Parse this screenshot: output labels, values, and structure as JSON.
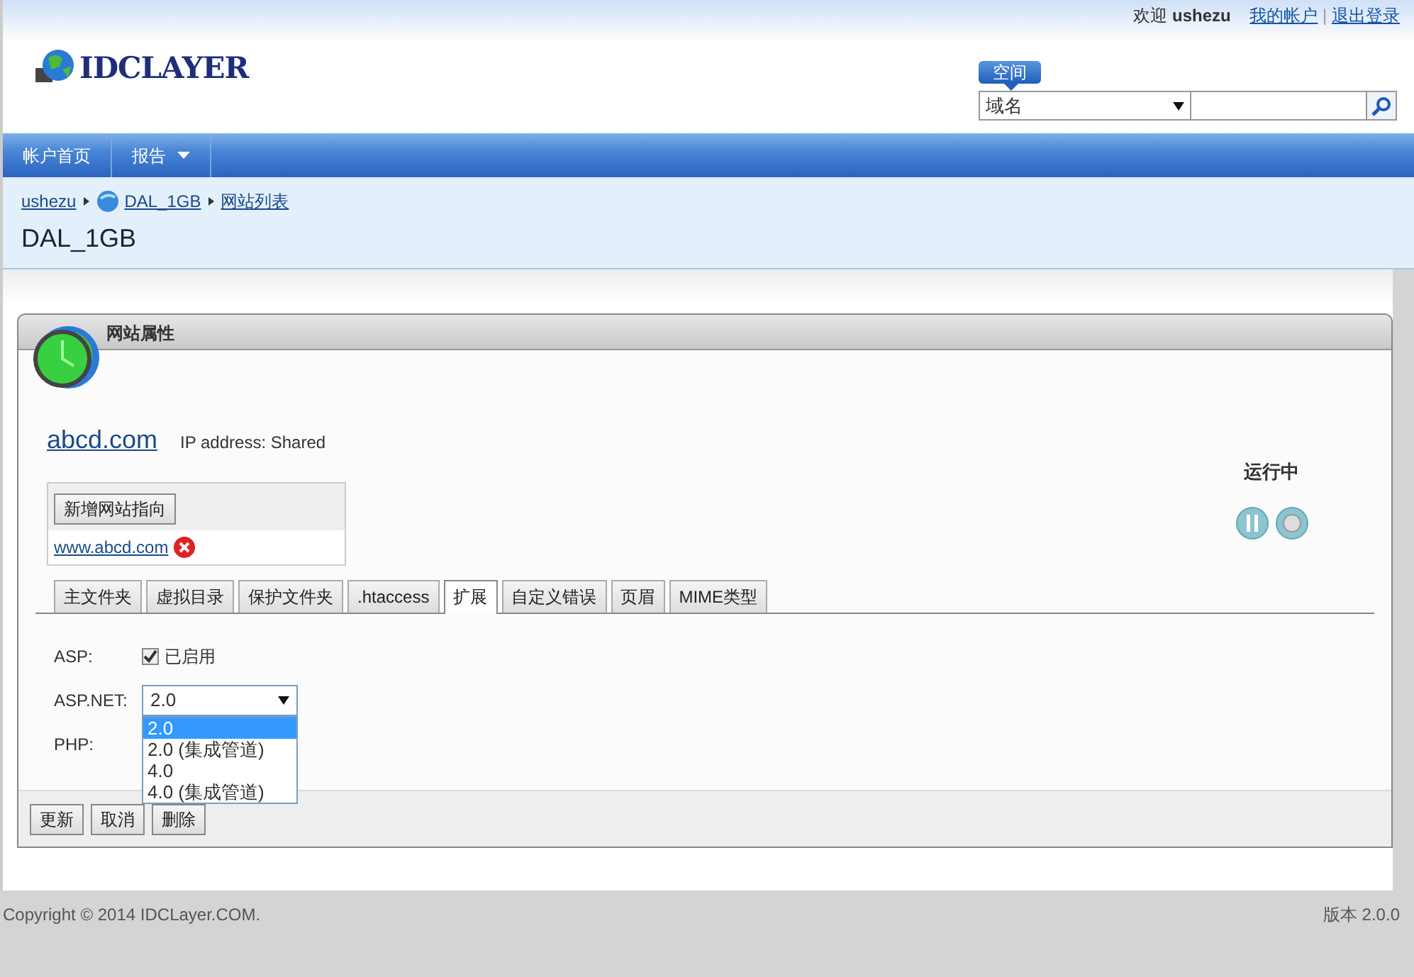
{
  "header": {
    "welcome": "欢迎",
    "user": "ushezu",
    "links": [
      "我的帐户",
      "退出登录"
    ],
    "separator": "|",
    "logo_text": "IDCLAYER",
    "search": {
      "scope_label": "空间",
      "type_value": "域名"
    }
  },
  "nav": [
    {
      "label": "帐户首页",
      "has_menu": false
    },
    {
      "label": "报告",
      "has_menu": true
    }
  ],
  "breadcrumb": [
    {
      "label": "ushezu",
      "kind": "user"
    },
    {
      "label": "DAL_1GB",
      "kind": "space"
    },
    {
      "label": "网站列表",
      "kind": "page"
    }
  ],
  "page_title": "DAL_1GB",
  "panel": {
    "title": "网站属性",
    "site_name": "abcd.com",
    "ip": "IP address: Shared",
    "status": "运行中",
    "pointers": {
      "add_button": "新增网站指向",
      "items": [
        "www.abcd.com"
      ]
    },
    "tabs": [
      {
        "label": "主文件夹",
        "selected": false
      },
      {
        "label": "虚拟目录",
        "selected": false
      },
      {
        "label": "保护文件夹",
        "selected": false
      },
      {
        "label": ".htaccess",
        "selected": false
      },
      {
        "label": "扩展",
        "selected": true
      },
      {
        "label": "自定义错误",
        "selected": false
      },
      {
        "label": "页眉",
        "selected": false
      },
      {
        "label": "MIME类型",
        "selected": false
      }
    ],
    "settings": [
      {
        "label": "ASP:",
        "kind": "checkbox",
        "checked": true,
        "text": "已启用"
      },
      {
        "label": "ASP.NET:",
        "kind": "select",
        "value": "2.0",
        "expanded": true,
        "options": [
          {
            "label": "2.0",
            "selected": true
          },
          {
            "label": "2.0 (集成管道)",
            "selected": false
          },
          {
            "label": "4.0",
            "selected": false
          },
          {
            "label": "4.0 (集成管道)",
            "selected": false
          }
        ]
      },
      {
        "label": "PHP:",
        "kind": "covered"
      }
    ],
    "buttons": [
      "更新",
      "取消",
      "删除"
    ]
  },
  "footer": {
    "copyright": "Copyright © 2014 IDCLayer.COM.",
    "version": "版本 2.0.0"
  }
}
